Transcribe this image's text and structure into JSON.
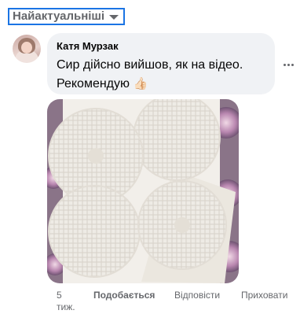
{
  "sort": {
    "label": "Найактуальніші",
    "icon": "chevron-down-icon",
    "border_color": "#1b74e4"
  },
  "comment": {
    "author": "Катя Мурзак",
    "text": "Сир дійсно вийшов, як на відео. Рекомендую",
    "emoji": "👍🏻",
    "bubble_color": "#f0f2f5",
    "has_photo": true,
    "photo_subject": "round cheeses on a floral cloth"
  },
  "actions": {
    "time": "5 тиж.",
    "like": "Подобається",
    "reply": "Відповісти",
    "hide": "Приховати"
  },
  "colors": {
    "secondary_text": "#65676b",
    "primary_text": "#050505"
  }
}
